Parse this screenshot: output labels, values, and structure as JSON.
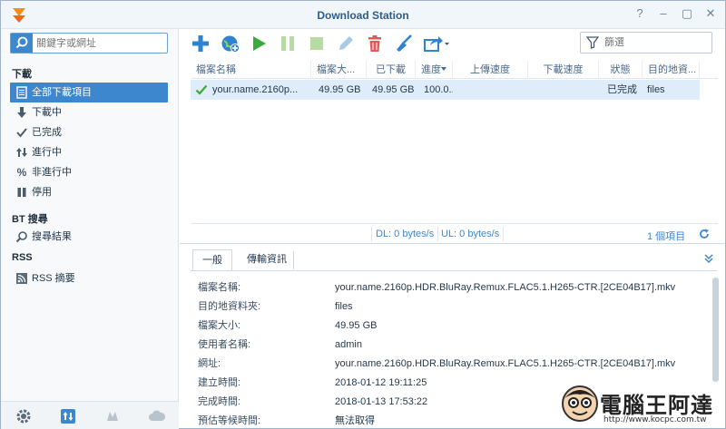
{
  "window": {
    "title": "Download Station"
  },
  "search": {
    "placeholder": "關鍵字或網址"
  },
  "sidebar": {
    "sections": [
      {
        "label": "下載"
      },
      {
        "label": "BT 搜尋"
      },
      {
        "label": "RSS"
      }
    ],
    "items": [
      {
        "label": "全部下載項目",
        "icon": "list-icon"
      },
      {
        "label": "下載中",
        "icon": "download-arrow-icon"
      },
      {
        "label": "已完成",
        "icon": "check-icon"
      },
      {
        "label": "進行中",
        "icon": "updown-arrows-icon"
      },
      {
        "label": "非進行中",
        "icon": "percent-icon"
      },
      {
        "label": "停用",
        "icon": "pause-icon"
      },
      {
        "label": "搜尋結果",
        "icon": "search-icon"
      },
      {
        "label": "RSS 摘要",
        "icon": "rss-icon"
      }
    ]
  },
  "toolbar": {
    "filter_placeholder": "篩選"
  },
  "table": {
    "headers": [
      "檔案名稱",
      "檔案大...",
      "已下載",
      "進度",
      "上傳速度",
      "下載速度",
      "狀態",
      "目的地資..."
    ],
    "rows": [
      {
        "name": "your.name.2160p...",
        "size": "49.95 GB",
        "downloaded": "49.95 GB",
        "progress": "100.0...",
        "up": "",
        "down": "",
        "status": "已完成",
        "dest": "files"
      }
    ]
  },
  "status": {
    "dl": "DL: 0 bytes/s",
    "ul": "UL: 0 bytes/s",
    "count": "1 個項目"
  },
  "details": {
    "tabs": [
      "一般",
      "傳輸資訊"
    ],
    "rows": [
      {
        "label": "檔案名稱:",
        "value": "your.name.2160p.HDR.BluRay.Remux.FLAC5.1.H265-CTR.[2CE04B17].mkv"
      },
      {
        "label": "目的地資料夾:",
        "value": "files"
      },
      {
        "label": "檔案大小:",
        "value": "49.95 GB"
      },
      {
        "label": "使用者名稱:",
        "value": "admin"
      },
      {
        "label": "網址:",
        "value": "your.name.2160p.HDR.BluRay.Remux.FLAC5.1.H265-CTR.[2CE04B17].mkv"
      },
      {
        "label": "建立時間:",
        "value": "2018-01-12 19:11:25"
      },
      {
        "label": "完成時間:",
        "value": "2018-01-13 17:53:22"
      },
      {
        "label": "預估等候時間:",
        "value": "無法取得"
      }
    ]
  },
  "watermark": {
    "title": "電腦王阿達",
    "url": "http://www.kocpc.com.tw"
  },
  "colors": {
    "accent": "#3d87cf",
    "selected_row": "#dfedfa",
    "play": "#3aaa3a",
    "delete": "#e05a5a"
  }
}
